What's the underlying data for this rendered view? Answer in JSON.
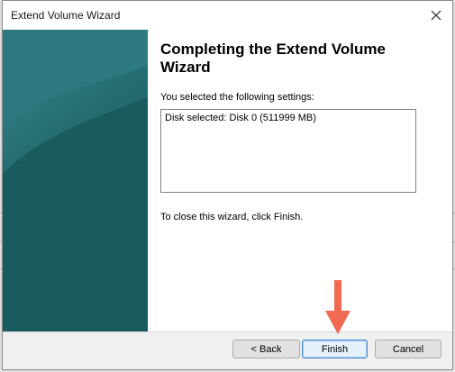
{
  "window": {
    "title": "Extend Volume Wizard"
  },
  "wizard": {
    "heading": "Completing the Extend Volume Wizard",
    "settings_label": "You selected the following settings:",
    "settings_lines": [
      "Disk selected: Disk 0 (511999 MB)"
    ],
    "close_hint": "To close this wizard, click Finish."
  },
  "buttons": {
    "back": "< Back",
    "finish": "Finish",
    "cancel": "Cancel"
  },
  "colors": {
    "side_panel": "#1f6469",
    "annotation_arrow": "#f06a52",
    "default_button_border": "#4a8ed2"
  },
  "icons": {
    "close": "close-icon"
  }
}
